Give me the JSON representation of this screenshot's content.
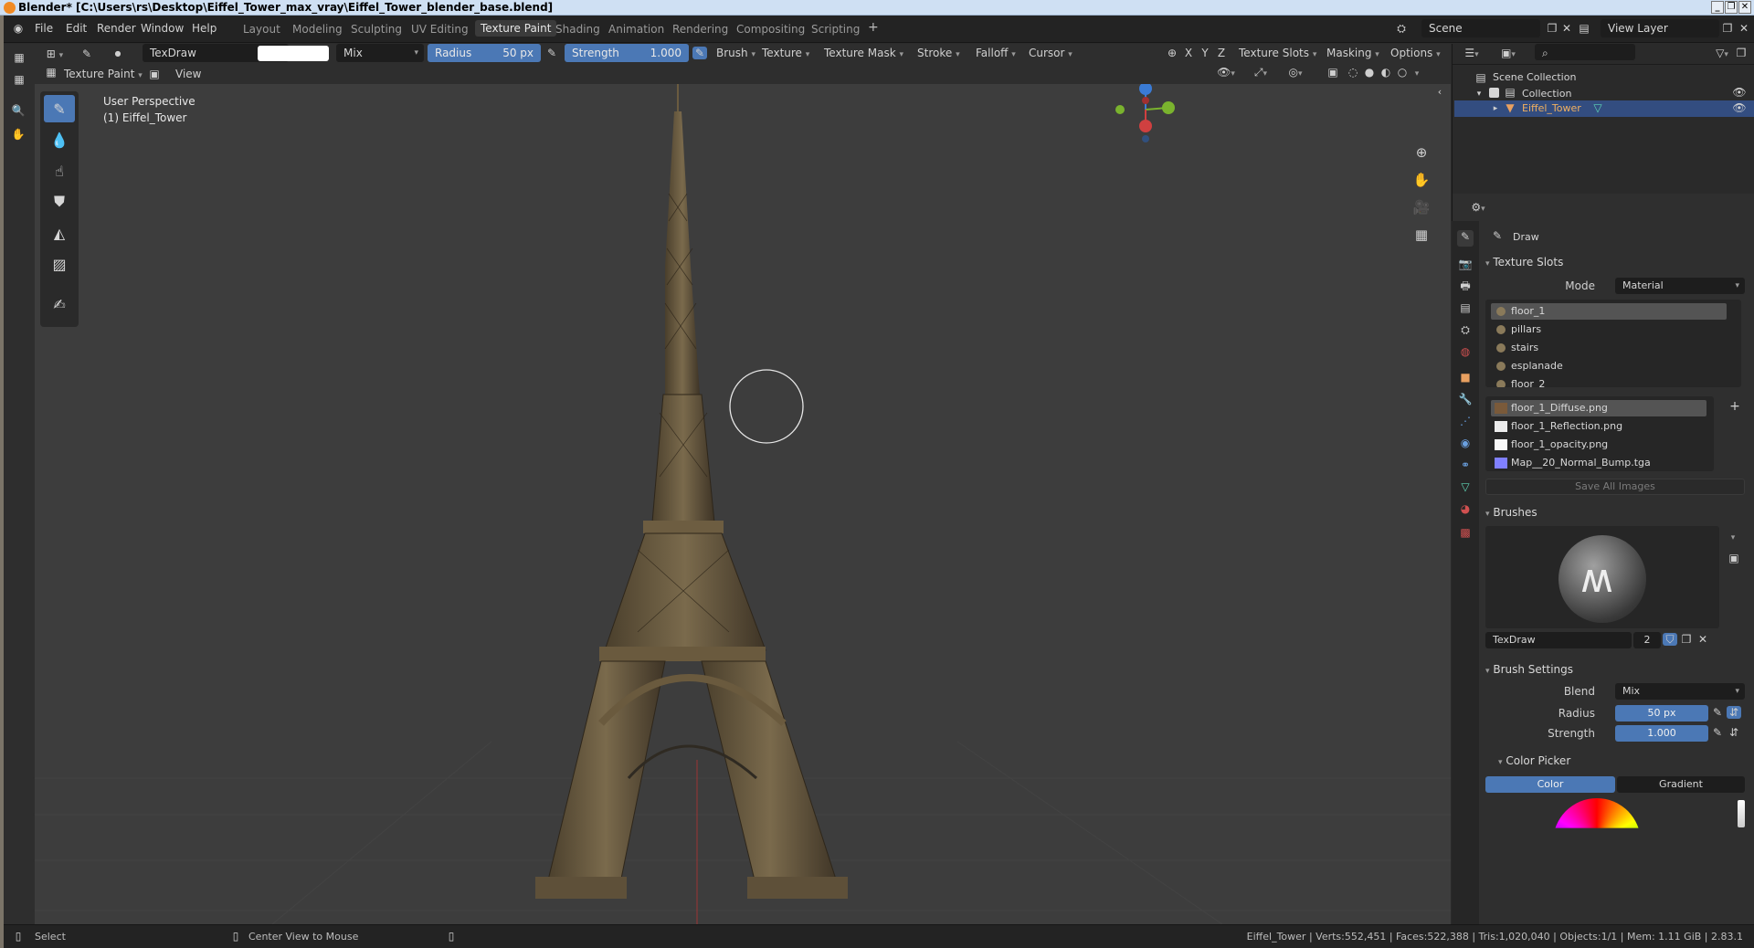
{
  "window": {
    "title": "Blender* [C:\\Users\\rs\\Desktop\\Eiffel_Tower_max_vray\\Eiffel_Tower_blender_base.blend]"
  },
  "menu": {
    "items": [
      "File",
      "Edit",
      "Render",
      "Window",
      "Help"
    ]
  },
  "workspaces": [
    "Layout",
    "Modeling",
    "Sculpting",
    "UV Editing",
    "Texture Paint",
    "Shading",
    "Animation",
    "Rendering",
    "Compositing",
    "Scripting"
  ],
  "active_workspace": "Texture Paint",
  "scene": {
    "name": "Scene",
    "view_layer": "View Layer"
  },
  "toolbar": {
    "brush_name": "TexDraw",
    "blend": "Mix",
    "radius_label": "Radius",
    "radius_value": "50 px",
    "strength_label": "Strength",
    "strength_value": "1.000",
    "dropdowns": [
      "Brush",
      "Texture",
      "Texture Mask",
      "Stroke",
      "Falloff",
      "Cursor"
    ],
    "axes": [
      "X",
      "Y",
      "Z"
    ],
    "right_dropdowns": [
      "Texture Slots",
      "Masking",
      "Options"
    ]
  },
  "viewport": {
    "mode": "Texture Paint",
    "view_menu": "View",
    "perspective": "User Perspective",
    "object_label": "(1) Eiffel_Tower"
  },
  "outliner": {
    "scene_collection": "Scene Collection",
    "collection": "Collection",
    "object": "Eiffel_Tower"
  },
  "properties": {
    "tool_name": "Draw",
    "texture_slots": {
      "header": "Texture Slots",
      "mode_label": "Mode",
      "mode_value": "Material",
      "materials": [
        "floor_1",
        "pillars",
        "stairs",
        "esplanade",
        "floor_2"
      ],
      "images": [
        "floor_1_Diffuse.png",
        "floor_1_Reflection.png",
        "floor_1_opacity.png",
        "Map__20_Normal_Bump.tga"
      ],
      "save_button": "Save All Images"
    },
    "brushes": {
      "header": "Brushes",
      "brush_name": "TexDraw",
      "users": "2"
    },
    "brush_settings": {
      "header": "Brush Settings",
      "blend_label": "Blend",
      "blend_value": "Mix",
      "radius_label": "Radius",
      "radius_value": "50 px",
      "strength_label": "Strength",
      "strength_value": "1.000"
    },
    "color_picker": {
      "header": "Color Picker",
      "tab_color": "Color",
      "tab_gradient": "Gradient"
    }
  },
  "statusbar": {
    "select": "Select",
    "center_view": "Center View to Mouse",
    "stats": "Eiffel_Tower | Verts:552,451 | Faces:522,388 | Tris:1,020,040 | Objects:1/1 | Mem: 1.11 GiB | 2.83.1"
  }
}
